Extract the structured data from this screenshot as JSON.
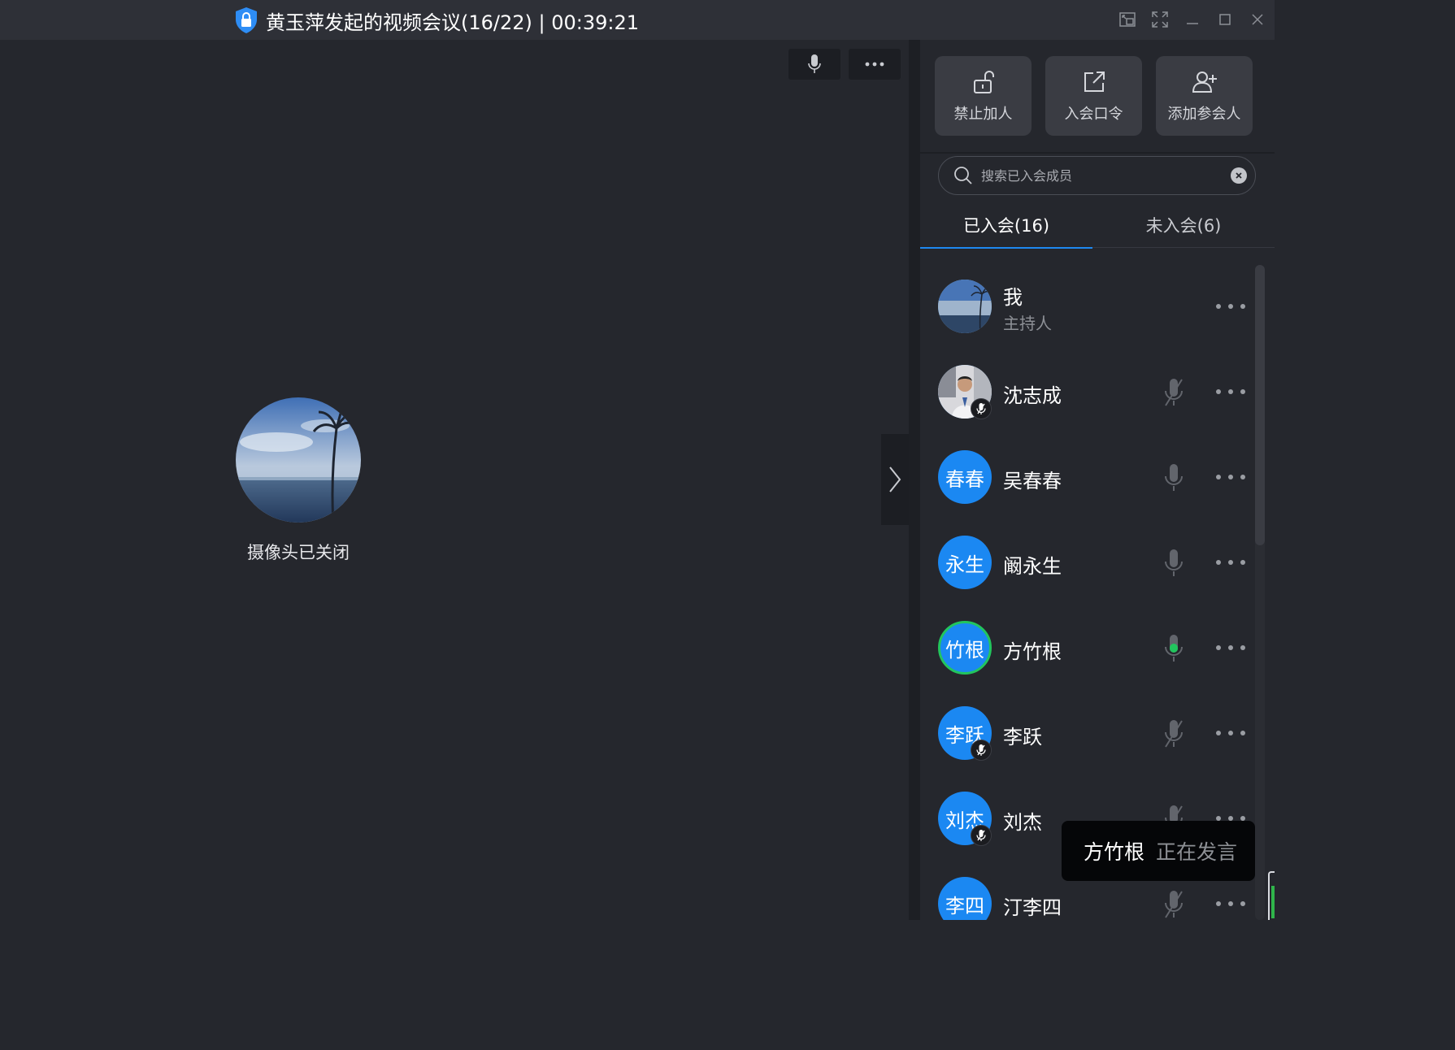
{
  "window": {
    "title": "黄玉萍发起的视频会议(16/22) | 00:39:21",
    "controls": [
      "pip-icon",
      "fullscreen-icon",
      "minimize-icon",
      "maximize-icon",
      "close-icon"
    ]
  },
  "stage": {
    "camera_status": "摄像头已关闭"
  },
  "panel": {
    "actions": [
      {
        "label": "禁止加人",
        "icon": "unlock-icon"
      },
      {
        "label": "入会口令",
        "icon": "share-icon"
      },
      {
        "label": "添加参会人",
        "icon": "add-user-icon"
      }
    ],
    "search": {
      "placeholder": "搜索已入会成员"
    },
    "tabs": [
      {
        "label": "已入会(16)",
        "active": true
      },
      {
        "label": "未入会(6)",
        "active": false
      }
    ],
    "members": [
      {
        "name": "我",
        "role": "主持人",
        "avatar_text": "",
        "avatar_type": "photo-beach",
        "mic": "none",
        "badge_muted": false
      },
      {
        "name": "沈志成",
        "role": "",
        "avatar_text": "",
        "avatar_type": "photo-person",
        "mic": "muted",
        "badge_muted": true
      },
      {
        "name": "吴春春",
        "role": "",
        "avatar_text": "春春",
        "avatar_type": "text",
        "mic": "on",
        "badge_muted": false
      },
      {
        "name": "阚永生",
        "role": "",
        "avatar_text": "永生",
        "avatar_type": "text",
        "mic": "on",
        "badge_muted": false
      },
      {
        "name": "方竹根",
        "role": "",
        "avatar_text": "竹根",
        "avatar_type": "text",
        "mic": "speaking",
        "badge_muted": false
      },
      {
        "name": "李跃",
        "role": "",
        "avatar_text": "李跃",
        "avatar_type": "text",
        "mic": "muted",
        "badge_muted": true
      },
      {
        "name": "刘杰",
        "role": "",
        "avatar_text": "刘杰",
        "avatar_type": "text",
        "mic": "muted",
        "badge_muted": true
      },
      {
        "name": "汀李四",
        "role": "",
        "avatar_text": "李四",
        "avatar_type": "text",
        "mic": "muted",
        "badge_muted": false
      }
    ]
  },
  "toast": {
    "name": "方竹根",
    "status": "正在发言"
  },
  "colors": {
    "accent": "#1e88f0",
    "avatar_blue": "#1b88f2",
    "speaking_green": "#22c55e",
    "background": "#25272d"
  }
}
